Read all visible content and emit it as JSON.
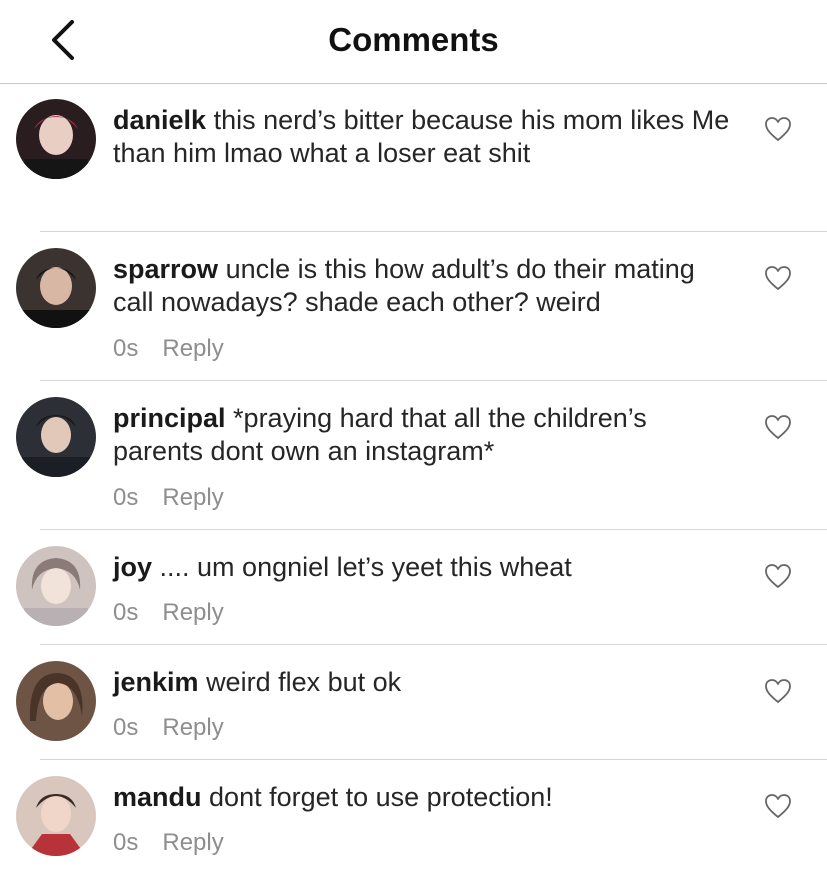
{
  "header": {
    "title": "Comments",
    "back_icon": "chevron-left-icon"
  },
  "comments": [
    {
      "username": "danielk",
      "text": "this nerd’s bitter because his mom likes Me than him lmao what a loser eat shit",
      "time": "",
      "reply_label": "",
      "avatar_color": "#3a2a2e"
    },
    {
      "username": "sparrow",
      "text": "uncle is this how adult’s do their mating call nowadays? shade each other? weird",
      "time": "0s",
      "reply_label": "Reply",
      "avatar_color": "#2b2422"
    },
    {
      "username": "principal",
      "text": "*praying hard that all the children’s parents dont own an instagram*",
      "time": "0s",
      "reply_label": "Reply",
      "avatar_color": "#2e3038"
    },
    {
      "username": "joy",
      "text": ".... um ongniel let’s yeet this wheat",
      "time": "0s",
      "reply_label": "Reply",
      "avatar_color": "#b9a9a6"
    },
    {
      "username": "jenkim",
      "text": "weird flex but ok",
      "time": "0s",
      "reply_label": "Reply",
      "avatar_color": "#8a6a55"
    },
    {
      "username": "mandu",
      "text": "dont forget to use protection!",
      "time": "0s",
      "reply_label": "Reply",
      "avatar_color": "#c9a99a"
    }
  ],
  "icons": {
    "like": "heart-outline-icon"
  }
}
